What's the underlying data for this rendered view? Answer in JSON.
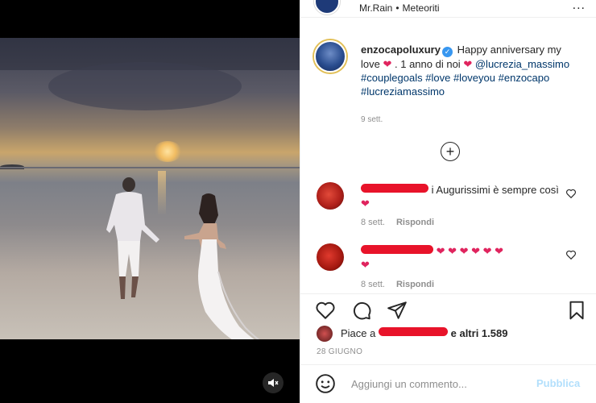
{
  "header": {
    "username": "Mr.Rain",
    "separator": "•",
    "song": "Meteoriti",
    "more": "..."
  },
  "caption": {
    "username": "enzocapoluxury",
    "verified_glyph": "✓",
    "text_1": "Happy anniversary my love",
    "heart": "❤",
    "text_2": ". 1 anno di noi",
    "mention": "@lucrezia_massimo",
    "hashtags": [
      "#couplegoals",
      "#love",
      "#loveyou",
      "#enzocapo",
      "#lucreziamassimo"
    ],
    "time": "9 sett."
  },
  "load_more_glyph": "+",
  "comments": [
    {
      "text_start": "i Augurissimi è sempre così",
      "heart": "❤",
      "time": "8 sett.",
      "reply": "Rispondi"
    },
    {
      "hearts": "❤ ❤ ❤ ❤ ❤ ❤",
      "heart_wrapped": "❤",
      "time": "8 sett.",
      "reply": "Rispondi"
    }
  ],
  "likes": {
    "prefix": "Piace a",
    "suffix": "e altri 1.589"
  },
  "date": "28 GIUGNO",
  "composer": {
    "placeholder": "Aggiungi un commento...",
    "publish": "Pubblica"
  },
  "icons": {
    "like": "heart-icon",
    "comment": "comment-icon",
    "share": "paper-plane-icon",
    "save": "bookmark-icon",
    "mute": "speaker-muted-icon",
    "emoji": "smiley-icon"
  },
  "colors": {
    "accent_link": "#00376b",
    "heart": "#e0245e",
    "redaction": "#e8132a",
    "publish_disabled": "#b2dffc",
    "verified": "#3897f0"
  }
}
